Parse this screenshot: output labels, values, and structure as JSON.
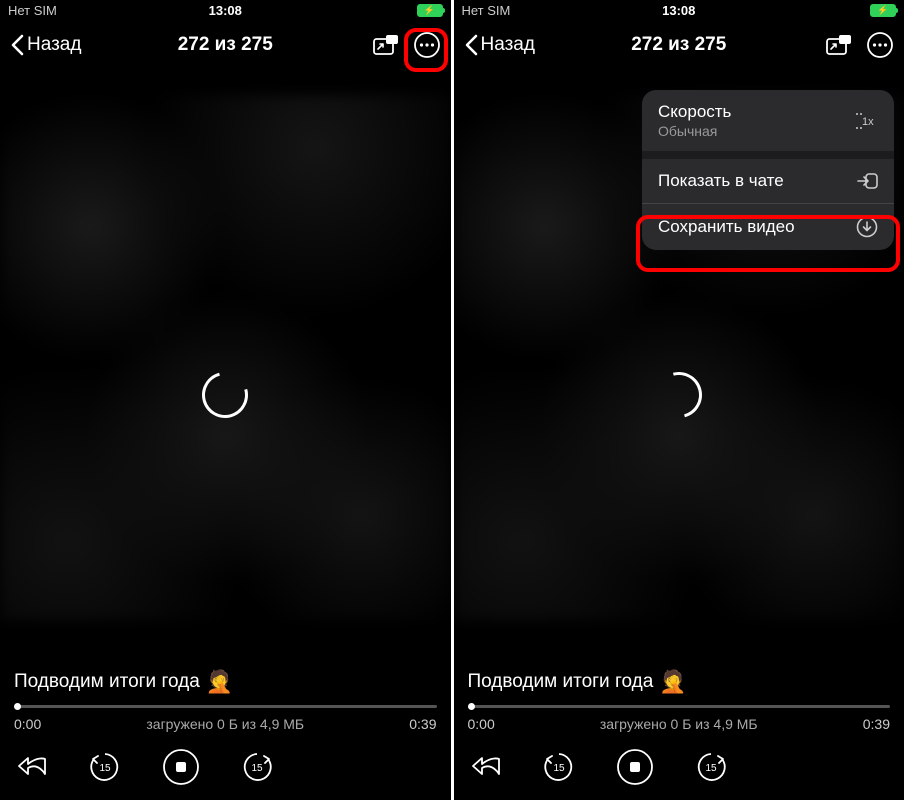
{
  "status": {
    "sim": "Нет SIM",
    "time": "13:08"
  },
  "nav": {
    "back_label": "Назад",
    "title": "272 из 275"
  },
  "caption": "Подводим итоги года",
  "caption_emoji": "🤦",
  "time": {
    "current": "0:00",
    "loaded": "загружено 0 Б из 4,9 МБ",
    "total": "0:39"
  },
  "menu": {
    "speed": {
      "label": "Скорость",
      "value": "Обычная",
      "badge": "1x"
    },
    "show_in_chat": "Показать в чате",
    "save_video": "Сохранить видео"
  }
}
